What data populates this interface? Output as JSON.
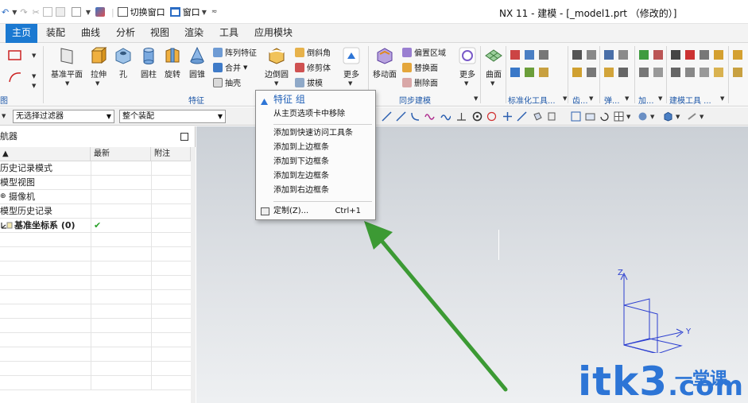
{
  "window": {
    "title": "NX 11 - 建模 - [_model1.prt （修改的）]",
    "switch_window_label": "切换窗口",
    "window_menu_label": "窗口"
  },
  "tabs": [
    {
      "label": "主页",
      "active": true
    },
    {
      "label": "装配"
    },
    {
      "label": "曲线"
    },
    {
      "label": "分析"
    },
    {
      "label": "视图"
    },
    {
      "label": "渲染"
    },
    {
      "label": "工具"
    },
    {
      "label": "应用模块"
    }
  ],
  "ribbon": {
    "large_buttons": {
      "datum_plane": "基准平面",
      "extrude": "拉伸",
      "hole": "孔",
      "cylinder": "圆柱",
      "revolve": "旋转",
      "cone": "圆锥",
      "edge_blend": "边倒圆",
      "more_feature": "更多",
      "move_face": "移动面",
      "more_sync": "更多",
      "surface": "曲面"
    },
    "small_buttons": {
      "pattern_feature": "阵列特征",
      "unite": "合并",
      "shell": "抽壳",
      "chamfer": "倒斜角",
      "trim_body": "修剪体",
      "draft": "拔模",
      "offset_region": "偏置区域",
      "replace_face": "替换面",
      "delete_face": "删除面"
    },
    "group_labels": {
      "sketch_partial": "图",
      "feature": "特征",
      "sync_modeling": "同步建模",
      "standard_tools": "标准化工具...",
      "gear": "齿...",
      "spring": "弹...",
      "add": "加...",
      "modeling_tools": "建模工具 ..."
    }
  },
  "filterbar": {
    "filter_value": "无选择过滤器",
    "scope_value": "整个装配"
  },
  "navigator": {
    "title": "航器",
    "columns": {
      "name": "▲",
      "latest": "最新",
      "note": "附注"
    },
    "rows": [
      {
        "name": "历史记录模式",
        "latest": ""
      },
      {
        "name": "模型视图",
        "latest": ""
      },
      {
        "name": "摄像机",
        "latest": ""
      },
      {
        "name": "模型历史记录",
        "latest": ""
      },
      {
        "name": "基准坐标系 (0)",
        "latest": "✔"
      }
    ]
  },
  "context_menu": {
    "header": "特征 组",
    "items": [
      "从主页选项卡中移除",
      "添加到快速访问工具条",
      "添加到上边框条",
      "添加到下边框条",
      "添加到左边框条",
      "添加到右边框条"
    ],
    "customize_label": "定制(Z)...",
    "customize_shortcut": "Ctrl+1"
  },
  "graphics": {
    "axis_labels": {
      "x": "X",
      "y": "Y",
      "z": "Z"
    },
    "watermark": "itk3",
    "watermark_suffix": ".com",
    "watermark_cn": "一堂课"
  }
}
